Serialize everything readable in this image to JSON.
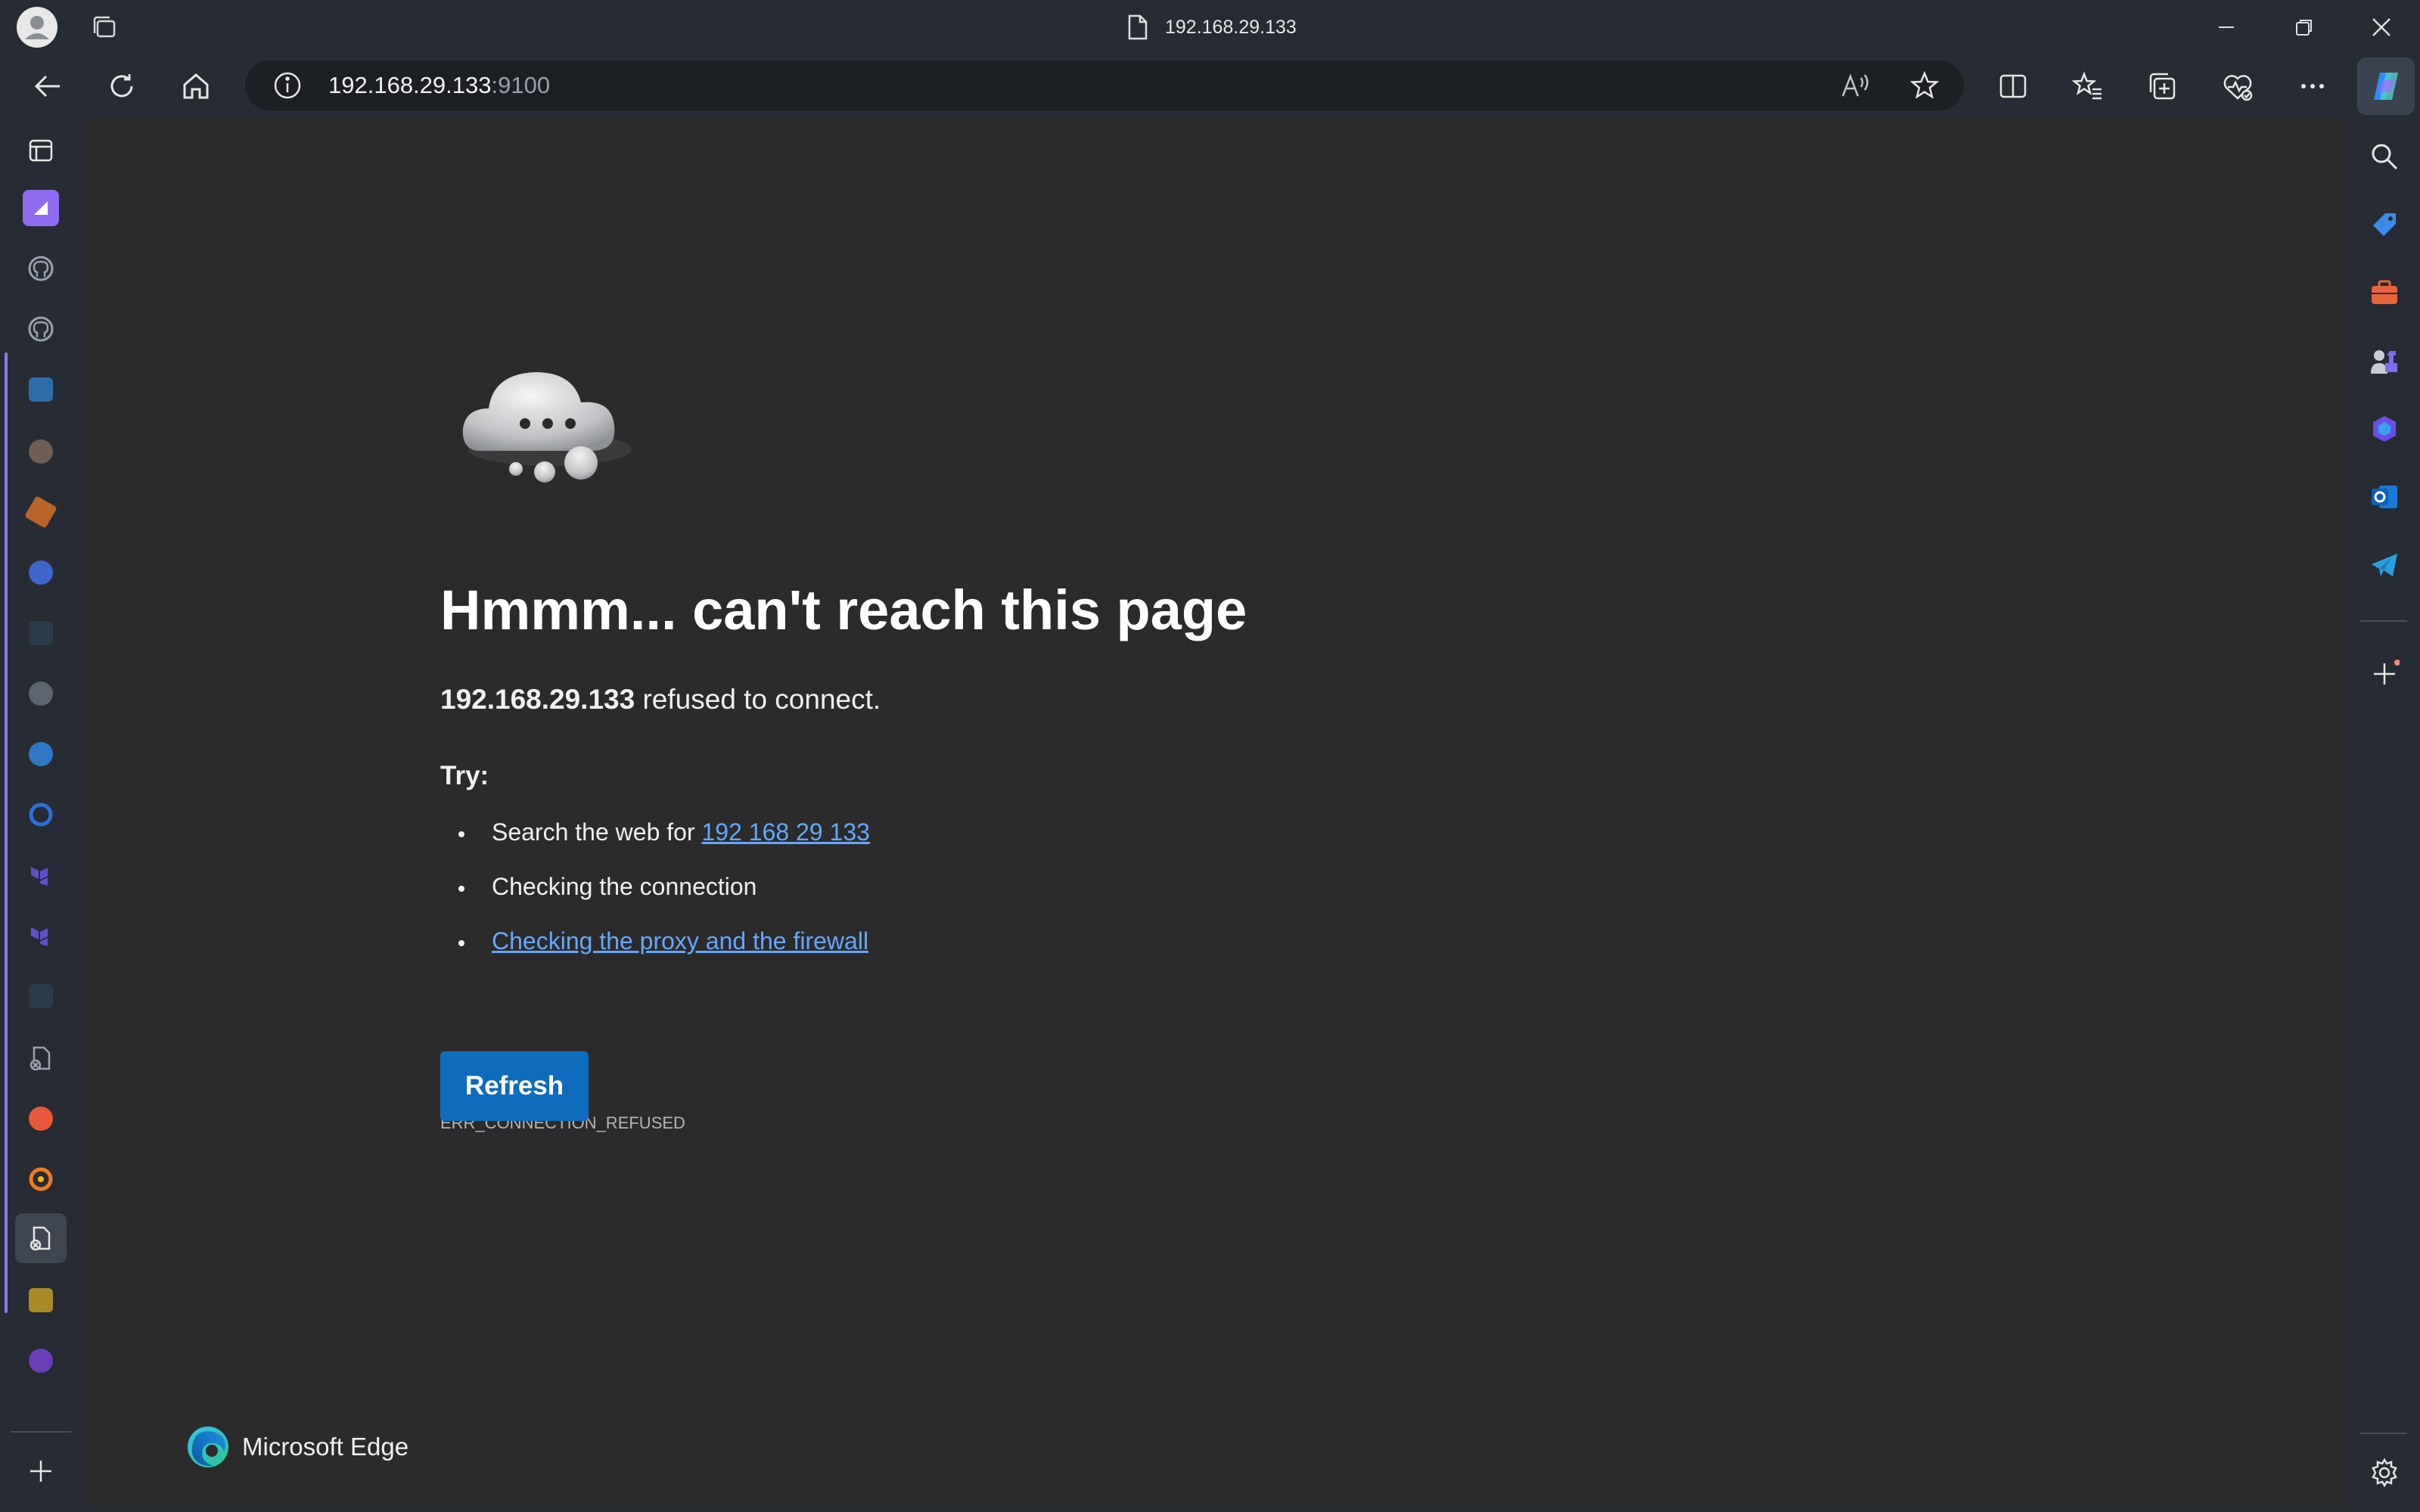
{
  "window": {
    "tab_title": "192.168.29.133",
    "icons": [
      "profile-icon",
      "workspaces-icon",
      "page-icon",
      "minimize-icon",
      "restore-icon",
      "close-icon"
    ]
  },
  "toolbar": {
    "address_host": "192.168.29.133",
    "address_port": ":9100",
    "icons": [
      "back-icon",
      "reload-icon",
      "home-icon",
      "site-info-icon",
      "read-aloud-icon",
      "favorite-star-icon",
      "split-screen-icon",
      "favorites-icon",
      "collections-icon",
      "browser-essentials-icon",
      "more-icon",
      "copilot-icon"
    ]
  },
  "vertical_tabs": {
    "icons": [
      "tab-actions-icon",
      "github-icon",
      "github-icon",
      "jenkins-icon",
      "avatar-icon",
      "package-icon",
      "kubernetes-icon",
      "avatar-icon",
      "octopus-icon",
      "digitalocean-icon",
      "terraform-icon",
      "terraform-icon",
      "error-page-icon",
      "grafana-icon",
      "error-page-icon",
      "new-tab-icon"
    ]
  },
  "page": {
    "heading": "Hmmm... can't reach this page",
    "desc_host": "192.168.29.133",
    "desc_rest": " refused to connect.",
    "try_label": "Try:",
    "suggestion_1_prefix": "Search the web for ",
    "suggestion_1_link": "192 168 29 133",
    "suggestion_2": "Checking the connection",
    "suggestion_3_link": "Checking the proxy and the firewall",
    "error_code": "ERR_CONNECTION_REFUSED",
    "refresh_label": "Refresh",
    "brand": "Microsoft Edge"
  },
  "right_sidebar": {
    "icons": [
      "search-icon",
      "shopping-tag-icon",
      "tools-icon",
      "games-icon",
      "microsoft365-icon",
      "outlook-icon",
      "telegram-icon",
      "add-icon",
      "settings-icon"
    ]
  },
  "colors": {
    "chrome_bg": "#272b33",
    "page_bg": "#2b2b2b",
    "link": "#64a8ff",
    "button": "#0f6cbd",
    "accent_line": "#8a7bf0"
  }
}
